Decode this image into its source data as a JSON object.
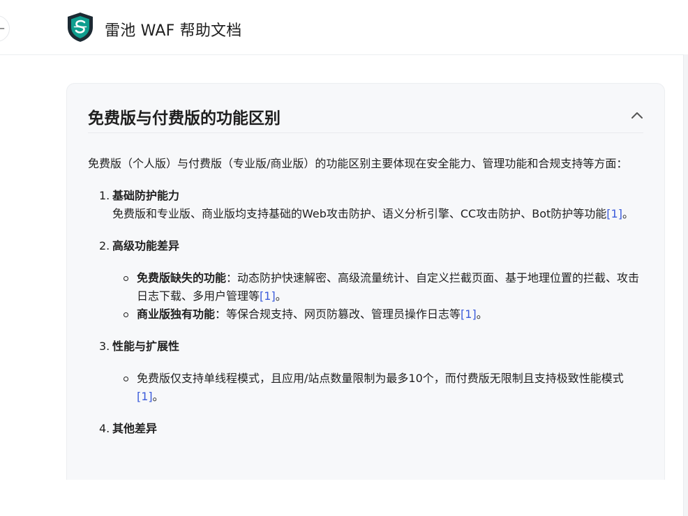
{
  "header": {
    "back_glyph": "←",
    "brand_title": "雷池 WAF 帮助文档",
    "logo_icon": "shield-logo",
    "brand_colors": {
      "shield": "#0f9e8f",
      "shield_dark": "#1c2a33"
    }
  },
  "card": {
    "title": "免费版与付费版的功能区别",
    "collapse_icon": "chevron-up",
    "intro": "免费版（个人版）与付费版（专业版/商业版）的功能区别主要体现在安全能力、管理功能和合规支持等方面：",
    "sections": [
      {
        "num": "1.",
        "heading": "基础防护能力",
        "body": "免费版和专业版、商业版均支持基础的Web攻击防护、语义分析引擎、CC攻击防护、Bot防护等功能",
        "cite": "[1]",
        "tail": "。"
      },
      {
        "num": "2.",
        "heading": "高级功能差异",
        "bullets": [
          {
            "label": "免费版缺失的功能",
            "text": "：动态防护快速解密、高级流量统计、自定义拦截页面、基于地理位置的拦截、攻击日志下载、多用户管理等",
            "cite": "[1]",
            "tail": "。"
          },
          {
            "label": "商业版独有功能",
            "text": "：等保合规支持、网页防篡改、管理员操作日志等",
            "cite": "[1]",
            "tail": "。"
          }
        ]
      },
      {
        "num": "3.",
        "heading": "性能与扩展性",
        "bullets": [
          {
            "label": "",
            "text": "免费版仅支持单线程模式，且应用/站点数量限制为最多10个，而付费版无限制且支持极致性能模式",
            "cite": "[1]",
            "tail": "。"
          }
        ]
      },
      {
        "num": "4.",
        "heading": "其他差异"
      }
    ]
  },
  "colors": {
    "accent_link": "#3b5bdb",
    "card_bg": "#f7f8fa",
    "text": "#1f1f1f"
  }
}
